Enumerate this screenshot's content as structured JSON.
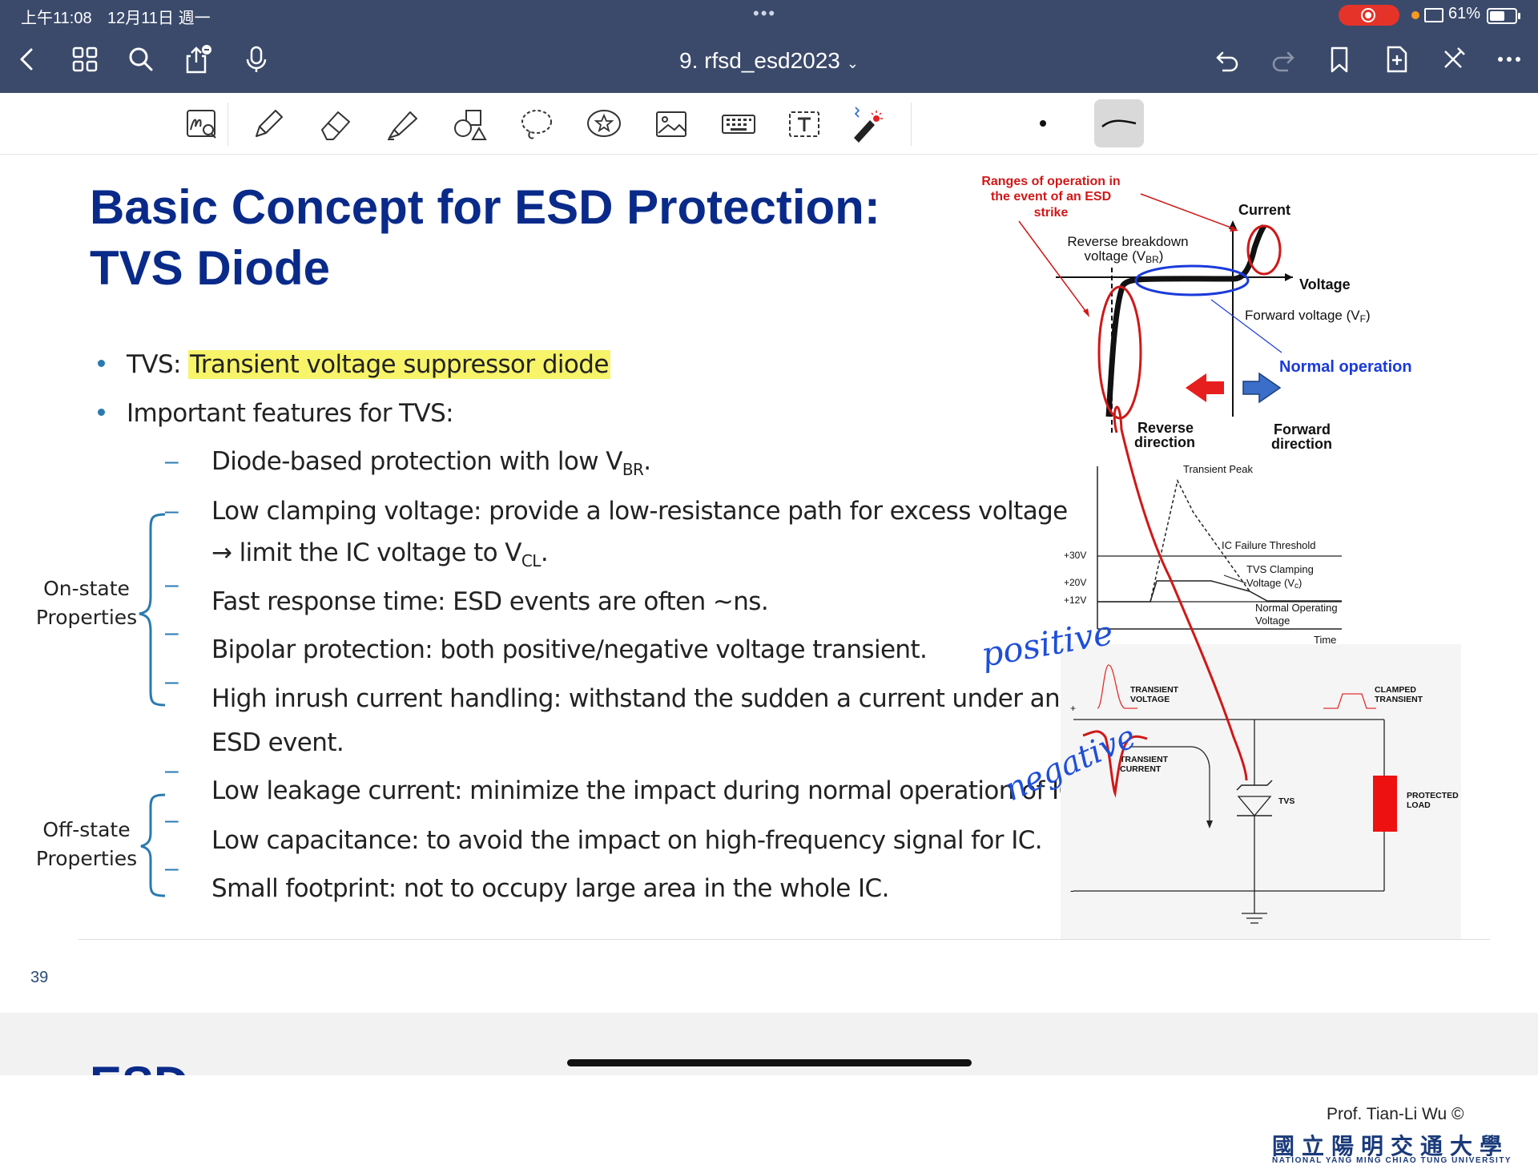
{
  "status_bar": {
    "time": "上午11:08",
    "date": "12月11日 週一",
    "dots": "•••",
    "battery": "61%"
  },
  "nav": {
    "document_title": "9. rfsd_esd2023",
    "title_caret": "⌄"
  },
  "slide": {
    "title_line1": "Basic Concept for ESD Protection:",
    "title_line2": "TVS Diode",
    "bullet1_prefix": "TVS: ",
    "bullet1_highlight": "Transient voltage suppressor diode",
    "bullet2": "Important features for TVS:",
    "item_diode": "Diode-based protection with low V",
    "item_diode_sub": "BR",
    "item_diode_end": ".",
    "item_clamp": "Low clamping voltage: provide a low-resistance path for excess voltage",
    "item_clamp_cont": "→ limit the IC voltage to V",
    "item_clamp_sub": "CL",
    "item_clamp_end": ".",
    "item_fast": "Fast response time:  ESD events are often ~ns.",
    "item_bipolar": "Bipolar protection: both positive/negative voltage transient.",
    "item_inrush": "High inrush current handling: withstand the sudden a current under an",
    "item_inrush_cont": "ESD event.",
    "item_leak": "Low leakage current: minimize the impact during normal operation of IC.",
    "item_cap": "Low capacitance: to avoid the impact on high-frequency signal for IC.",
    "item_foot": "Small footprint: not to occupy large area in the whole IC.",
    "onstate_label_1": "On-state",
    "onstate_label_2": "Properties",
    "offstate_label_1": "Off-state",
    "offstate_label_2": "Properties",
    "dash": "–",
    "page_number": "39",
    "credit": "Prof. Tian-Li Wu ©",
    "university_cn": "國立陽明交通大學",
    "university_en": "NATIONAL YANG MING CHIAO TUNG UNIVERSITY"
  },
  "iv_diagram": {
    "annotation_ranges": [
      "Ranges of operation in",
      "the event of an ESD",
      "strike"
    ],
    "axis_current": "Current",
    "axis_voltage": "Voltage",
    "reverse_breakdown": [
      "Reverse breakdown",
      "voltage (V"
    ],
    "reverse_breakdown_sub": "BR",
    "forward_voltage": "Forward voltage (V",
    "forward_voltage_sub": "F",
    "normal_operation": "Normal operation",
    "reverse_direction": [
      "Reverse",
      "direction"
    ],
    "forward_direction": [
      "Forward",
      "direction"
    ]
  },
  "transient_diagram": {
    "transient_peak": "Transient Peak",
    "ic_failure": "IC Failure Threshold",
    "tvs_clamping": [
      "TVS Clamping",
      "Voltage (V"
    ],
    "tvs_clamping_sub": "c",
    "normal_operating": [
      "Normal Operating",
      "Voltage"
    ],
    "time": "Time",
    "v30": "+30V",
    "v20": "+20V",
    "v12": "+12V"
  },
  "circuit_diagram": {
    "transient_voltage": [
      "TRANSIENT",
      "VOLTAGE"
    ],
    "clamped_transient": [
      "CLAMPED",
      "TRANSIENT"
    ],
    "transient_current": [
      "TRANSIENT",
      "CURRENT"
    ],
    "tvs": "TVS",
    "protected_load": [
      "PROTECTED",
      "LOAD"
    ],
    "plus": "+",
    "minus": "-"
  },
  "handwriting": {
    "positive": "positive",
    "negative": "negative"
  },
  "colors": {
    "nav_bg": "#3b4a6b",
    "title_blue": "#0a2a8a",
    "highlight": "#f7f46a",
    "annotation_red": "#d01818",
    "handwriting_blue": "#1f4fd8"
  }
}
